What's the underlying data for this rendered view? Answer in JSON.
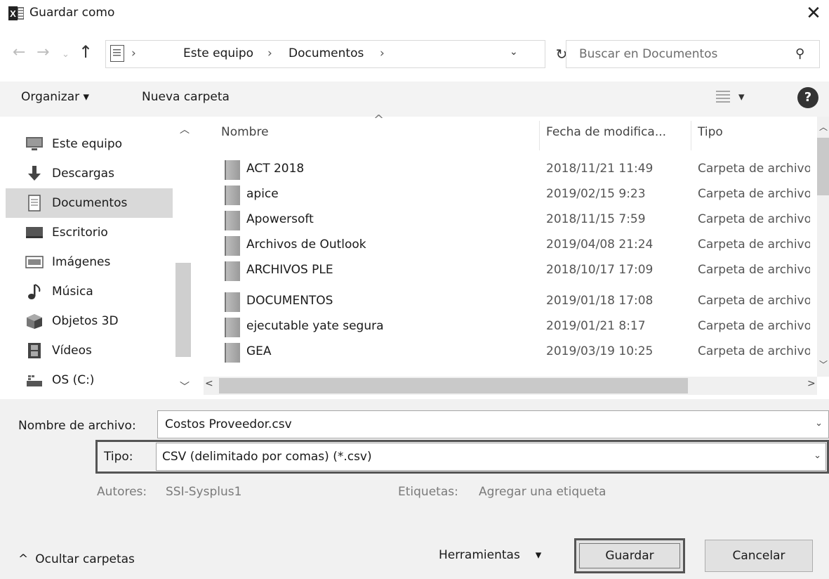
{
  "window": {
    "title": "Guardar como",
    "app_icon_letter": "X"
  },
  "address": {
    "crumbs": [
      "Este equipo",
      "Documentos"
    ],
    "separator": "›",
    "search_placeholder": "Buscar en Documentos"
  },
  "toolbar": {
    "organize": "Organizar ▾",
    "new_folder": "Nueva carpeta",
    "help": "?",
    "view_dd": "▾"
  },
  "sidebar": {
    "items": [
      {
        "label": "Este equipo",
        "icon": "computer-icon"
      },
      {
        "label": "Descargas",
        "icon": "download-icon"
      },
      {
        "label": "Documentos",
        "icon": "document-icon",
        "selected": true
      },
      {
        "label": "Escritorio",
        "icon": "desktop-icon"
      },
      {
        "label": "Imágenes",
        "icon": "images-icon"
      },
      {
        "label": "Música",
        "icon": "music-icon"
      },
      {
        "label": "Objetos 3D",
        "icon": "3d-objects-icon"
      },
      {
        "label": "Vídeos",
        "icon": "video-icon"
      },
      {
        "label": "OS (C:)",
        "icon": "drive-icon"
      }
    ]
  },
  "filelist": {
    "columns": {
      "name": "Nombre",
      "date": "Fecha de modifica...",
      "type": "Tipo"
    },
    "rows": [
      {
        "name": "ACT 2018",
        "date": "2018/11/21 11:49",
        "type": "Carpeta de archivos"
      },
      {
        "name": "apice",
        "date": "2019/02/15 9:23",
        "type": "Carpeta de archivos"
      },
      {
        "name": "Apowersoft",
        "date": "2018/11/15 7:59",
        "type": "Carpeta de archivos"
      },
      {
        "name": "Archivos de Outlook",
        "date": "2019/04/08 21:24",
        "type": "Carpeta de archivos"
      },
      {
        "name": "ARCHIVOS PLE",
        "date": "2018/10/17 17:09",
        "type": "Carpeta de archivos"
      },
      {
        "name": "DOCUMENTOS",
        "date": "2019/01/18 17:08",
        "type": "Carpeta de archivos"
      },
      {
        "name": "ejecutable yate segura",
        "date": "2019/01/21 8:17",
        "type": "Carpeta de archivos"
      },
      {
        "name": "GEA",
        "date": "2019/03/19 10:25",
        "type": "Carpeta de archivos"
      }
    ]
  },
  "form": {
    "filename_label": "Nombre de archivo:",
    "filename_value": "Costos Proveedor.csv",
    "type_label": "Tipo:",
    "type_value": "CSV (delimitado por comas) (*.csv)",
    "authors_label": "Autores:",
    "authors_value": "SSI-Sysplus1",
    "tags_label": "Etiquetas:",
    "tags_value": "Agregar una etiqueta"
  },
  "footer": {
    "hide_folders": "Ocultar carpetas",
    "tools": "Herramientas",
    "save": "Guardar",
    "cancel": "Cancelar"
  }
}
